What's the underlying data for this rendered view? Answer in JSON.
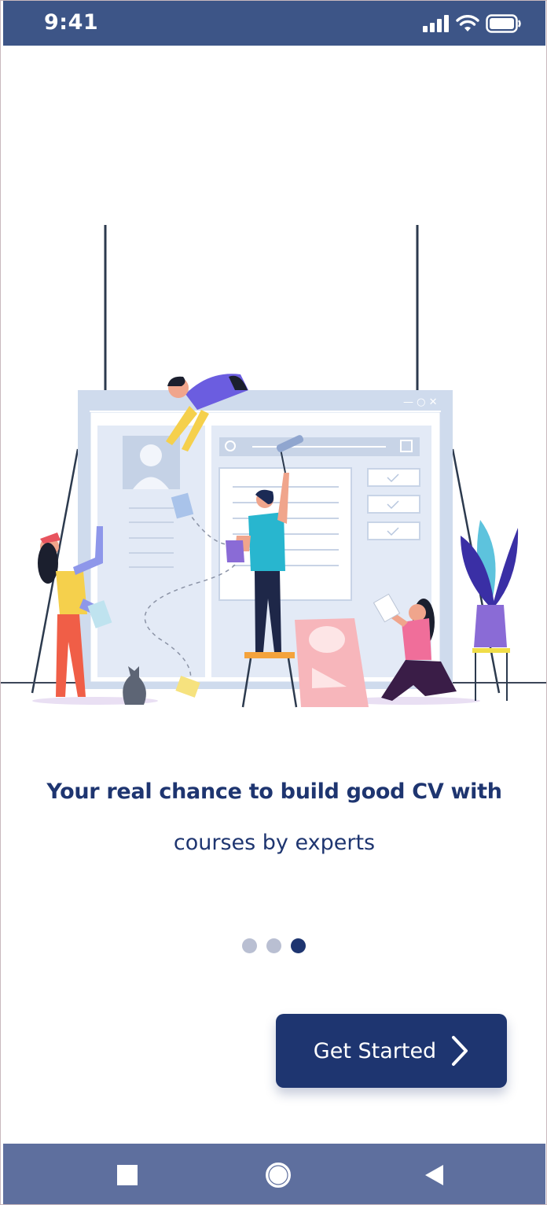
{
  "status_bar": {
    "time": "9:41",
    "icons": [
      "signal-icon",
      "wifi-icon",
      "battery-icon"
    ],
    "background": "#3d5587"
  },
  "onboarding": {
    "headline": "Your real chance to build good CV with",
    "subline": "courses by experts",
    "page_indicator": {
      "total": 3,
      "active_index": 2
    },
    "cta_label": "Get Started",
    "cta_icon": "chevron-right-icon",
    "accent": "#1e3570"
  },
  "nav_bar": {
    "buttons": [
      "recent-apps-icon",
      "home-icon",
      "back-icon"
    ],
    "background": "#5e6f9e"
  }
}
